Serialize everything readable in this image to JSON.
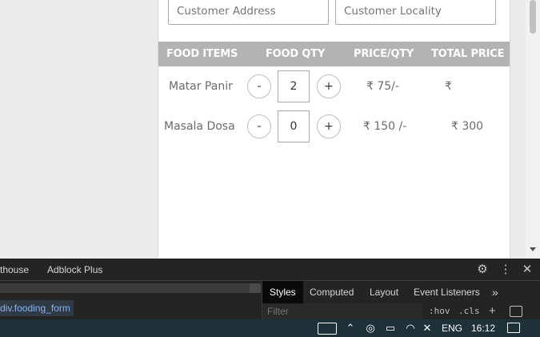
{
  "form": {
    "address_placeholder": "Customer Address",
    "locality_placeholder": "Customer Locality"
  },
  "table": {
    "headers": [
      "FOOD ITEMS",
      "FOOD QTY",
      "PRICE/QTY",
      "TOTAL PRICE"
    ],
    "rows": [
      {
        "item": "Matar Panir",
        "minus": "-",
        "qty": "2",
        "plus": "+",
        "price": "₹ 75/-",
        "total": "₹"
      },
      {
        "item": "Masala Dosa",
        "minus": "-",
        "qty": "0",
        "plus": "+",
        "price": "₹ 150 /-",
        "total": "₹ 300"
      }
    ]
  },
  "devtools": {
    "tabs": [
      "thouse",
      "Adblock Plus"
    ],
    "breadcrumb": "div.fooding_form",
    "styles_tabs": [
      "Styles",
      "Computed",
      "Layout",
      "Event Listeners"
    ],
    "more": "»",
    "filter_placeholder": "Filter",
    "hov": ":hov",
    "cls": ".cls",
    "icons": [
      "gear-icon",
      "kebab-icon",
      "close-icon"
    ]
  },
  "taskbar": {
    "lang": "ENG",
    "clock": "16:12",
    "icons": [
      "news-icon",
      "chevron-up-icon",
      "meet-icon",
      "battery-icon",
      "wifi-icon",
      "volume-muted-icon",
      "notification-icon"
    ]
  }
}
